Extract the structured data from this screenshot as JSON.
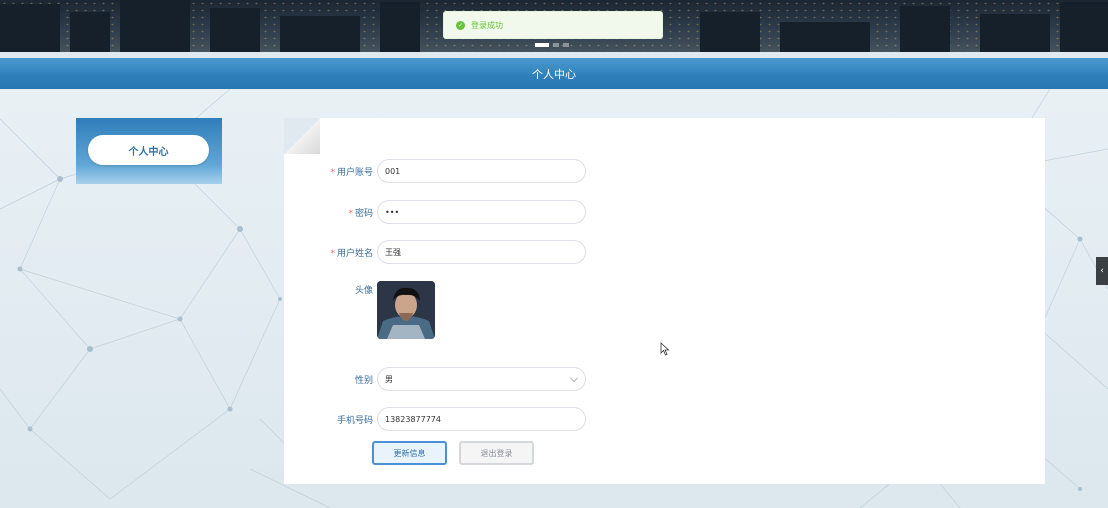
{
  "toast": {
    "icon": "check-circle-icon",
    "message": "登录成功"
  },
  "header": {
    "title": "个人中心"
  },
  "sidebar": {
    "items": [
      {
        "label": "个人中心"
      }
    ]
  },
  "form": {
    "account": {
      "label": "用户账号",
      "required": true,
      "value": "001"
    },
    "password": {
      "label": "密码",
      "required": true,
      "value": "•••"
    },
    "name": {
      "label": "用户姓名",
      "required": true,
      "value": "王强"
    },
    "avatar": {
      "label": "头像"
    },
    "gender": {
      "label": "性别",
      "value": "男"
    },
    "phone": {
      "label": "手机号码",
      "value": "13823877774"
    }
  },
  "buttons": {
    "update": "更新信息",
    "logout": "退出登录"
  },
  "colors": {
    "accent": "#2f7fba",
    "success": "#67c23a",
    "required": "#f56c6c"
  }
}
